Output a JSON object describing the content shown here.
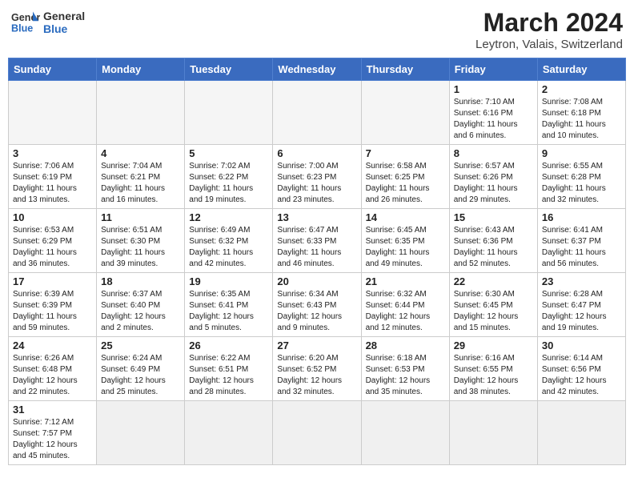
{
  "header": {
    "logo_general": "General",
    "logo_blue": "Blue",
    "month_year": "March 2024",
    "location": "Leytron, Valais, Switzerland"
  },
  "days_of_week": [
    "Sunday",
    "Monday",
    "Tuesday",
    "Wednesday",
    "Thursday",
    "Friday",
    "Saturday"
  ],
  "weeks": [
    [
      {
        "day": "",
        "info": ""
      },
      {
        "day": "",
        "info": ""
      },
      {
        "day": "",
        "info": ""
      },
      {
        "day": "",
        "info": ""
      },
      {
        "day": "",
        "info": ""
      },
      {
        "day": "1",
        "info": "Sunrise: 7:10 AM\nSunset: 6:16 PM\nDaylight: 11 hours and 6 minutes."
      },
      {
        "day": "2",
        "info": "Sunrise: 7:08 AM\nSunset: 6:18 PM\nDaylight: 11 hours and 10 minutes."
      }
    ],
    [
      {
        "day": "3",
        "info": "Sunrise: 7:06 AM\nSunset: 6:19 PM\nDaylight: 11 hours and 13 minutes."
      },
      {
        "day": "4",
        "info": "Sunrise: 7:04 AM\nSunset: 6:21 PM\nDaylight: 11 hours and 16 minutes."
      },
      {
        "day": "5",
        "info": "Sunrise: 7:02 AM\nSunset: 6:22 PM\nDaylight: 11 hours and 19 minutes."
      },
      {
        "day": "6",
        "info": "Sunrise: 7:00 AM\nSunset: 6:23 PM\nDaylight: 11 hours and 23 minutes."
      },
      {
        "day": "7",
        "info": "Sunrise: 6:58 AM\nSunset: 6:25 PM\nDaylight: 11 hours and 26 minutes."
      },
      {
        "day": "8",
        "info": "Sunrise: 6:57 AM\nSunset: 6:26 PM\nDaylight: 11 hours and 29 minutes."
      },
      {
        "day": "9",
        "info": "Sunrise: 6:55 AM\nSunset: 6:28 PM\nDaylight: 11 hours and 32 minutes."
      }
    ],
    [
      {
        "day": "10",
        "info": "Sunrise: 6:53 AM\nSunset: 6:29 PM\nDaylight: 11 hours and 36 minutes."
      },
      {
        "day": "11",
        "info": "Sunrise: 6:51 AM\nSunset: 6:30 PM\nDaylight: 11 hours and 39 minutes."
      },
      {
        "day": "12",
        "info": "Sunrise: 6:49 AM\nSunset: 6:32 PM\nDaylight: 11 hours and 42 minutes."
      },
      {
        "day": "13",
        "info": "Sunrise: 6:47 AM\nSunset: 6:33 PM\nDaylight: 11 hours and 46 minutes."
      },
      {
        "day": "14",
        "info": "Sunrise: 6:45 AM\nSunset: 6:35 PM\nDaylight: 11 hours and 49 minutes."
      },
      {
        "day": "15",
        "info": "Sunrise: 6:43 AM\nSunset: 6:36 PM\nDaylight: 11 hours and 52 minutes."
      },
      {
        "day": "16",
        "info": "Sunrise: 6:41 AM\nSunset: 6:37 PM\nDaylight: 11 hours and 56 minutes."
      }
    ],
    [
      {
        "day": "17",
        "info": "Sunrise: 6:39 AM\nSunset: 6:39 PM\nDaylight: 11 hours and 59 minutes."
      },
      {
        "day": "18",
        "info": "Sunrise: 6:37 AM\nSunset: 6:40 PM\nDaylight: 12 hours and 2 minutes."
      },
      {
        "day": "19",
        "info": "Sunrise: 6:35 AM\nSunset: 6:41 PM\nDaylight: 12 hours and 5 minutes."
      },
      {
        "day": "20",
        "info": "Sunrise: 6:34 AM\nSunset: 6:43 PM\nDaylight: 12 hours and 9 minutes."
      },
      {
        "day": "21",
        "info": "Sunrise: 6:32 AM\nSunset: 6:44 PM\nDaylight: 12 hours and 12 minutes."
      },
      {
        "day": "22",
        "info": "Sunrise: 6:30 AM\nSunset: 6:45 PM\nDaylight: 12 hours and 15 minutes."
      },
      {
        "day": "23",
        "info": "Sunrise: 6:28 AM\nSunset: 6:47 PM\nDaylight: 12 hours and 19 minutes."
      }
    ],
    [
      {
        "day": "24",
        "info": "Sunrise: 6:26 AM\nSunset: 6:48 PM\nDaylight: 12 hours and 22 minutes."
      },
      {
        "day": "25",
        "info": "Sunrise: 6:24 AM\nSunset: 6:49 PM\nDaylight: 12 hours and 25 minutes."
      },
      {
        "day": "26",
        "info": "Sunrise: 6:22 AM\nSunset: 6:51 PM\nDaylight: 12 hours and 28 minutes."
      },
      {
        "day": "27",
        "info": "Sunrise: 6:20 AM\nSunset: 6:52 PM\nDaylight: 12 hours and 32 minutes."
      },
      {
        "day": "28",
        "info": "Sunrise: 6:18 AM\nSunset: 6:53 PM\nDaylight: 12 hours and 35 minutes."
      },
      {
        "day": "29",
        "info": "Sunrise: 6:16 AM\nSunset: 6:55 PM\nDaylight: 12 hours and 38 minutes."
      },
      {
        "day": "30",
        "info": "Sunrise: 6:14 AM\nSunset: 6:56 PM\nDaylight: 12 hours and 42 minutes."
      }
    ],
    [
      {
        "day": "31",
        "info": "Sunrise: 7:12 AM\nSunset: 7:57 PM\nDaylight: 12 hours and 45 minutes."
      },
      {
        "day": "",
        "info": ""
      },
      {
        "day": "",
        "info": ""
      },
      {
        "day": "",
        "info": ""
      },
      {
        "day": "",
        "info": ""
      },
      {
        "day": "",
        "info": ""
      },
      {
        "day": "",
        "info": ""
      }
    ]
  ]
}
